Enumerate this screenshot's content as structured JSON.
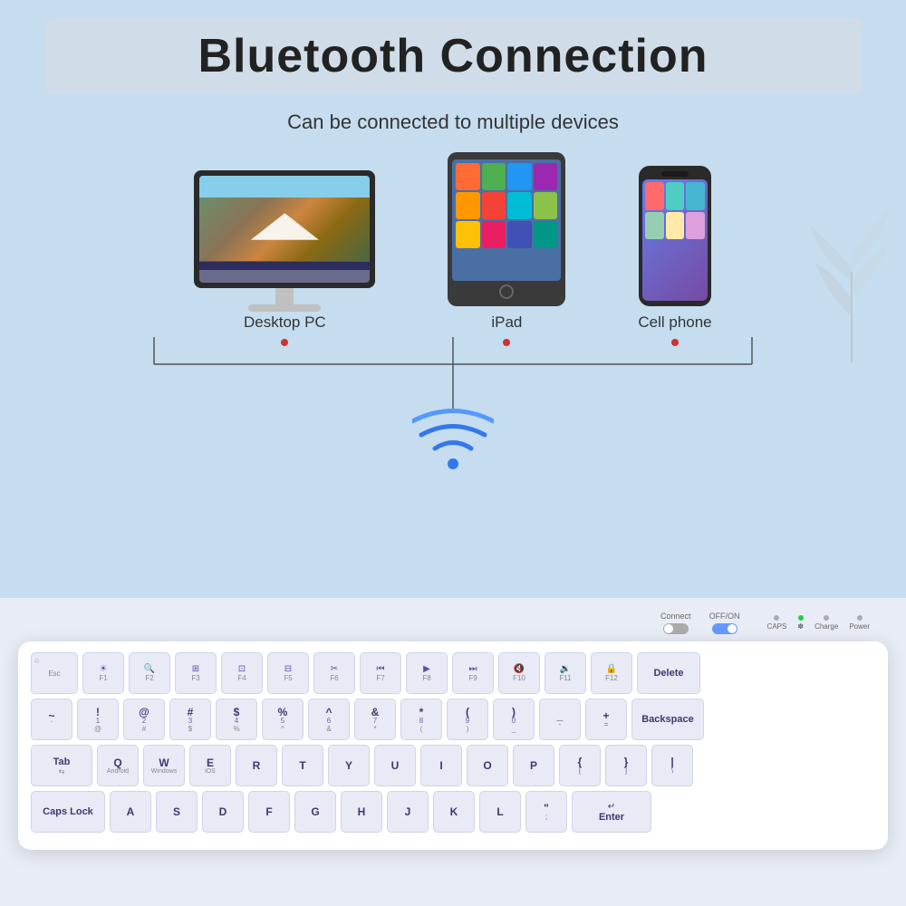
{
  "header": {
    "title": "Bluetooth Connection",
    "subtitle": "Can be connected to multiple devices"
  },
  "devices": [
    {
      "label": "Desktop PC",
      "type": "mac"
    },
    {
      "label": "iPad",
      "type": "ipad"
    },
    {
      "label": "Cell phone",
      "type": "phone"
    }
  ],
  "status": {
    "connect_label": "Connect",
    "offon_label": "OFF/ON",
    "caps_label": "CAPS",
    "bluetooth_label": "✽",
    "charge_label": "Charge",
    "power_label": "Power"
  },
  "keyboard": {
    "rows": [
      [
        "Esc/F0",
        "F1",
        "F2",
        "F3",
        "F4",
        "F5",
        "F6",
        "F7",
        "F8",
        "F9",
        "F10",
        "F11",
        "F12",
        "Delete"
      ],
      [
        "~/`",
        "1/@",
        "2/#",
        "3/$",
        "4/%",
        "5/^",
        "6/&",
        "7/*",
        "8/(",
        "9/)",
        "0/_",
        "-/—",
        "+/=",
        "Backspace"
      ],
      [
        "Tab",
        "Q",
        "W",
        "E",
        "R",
        "T",
        "Y",
        "U",
        "I",
        "O",
        "P",
        "{/[",
        "}/]",
        "|/\\"
      ],
      [
        "Caps Lock",
        "A",
        "S",
        "D",
        "F",
        "G",
        "H",
        "J",
        "K",
        "L",
        ";\"/:",
        "Enter"
      ]
    ]
  }
}
